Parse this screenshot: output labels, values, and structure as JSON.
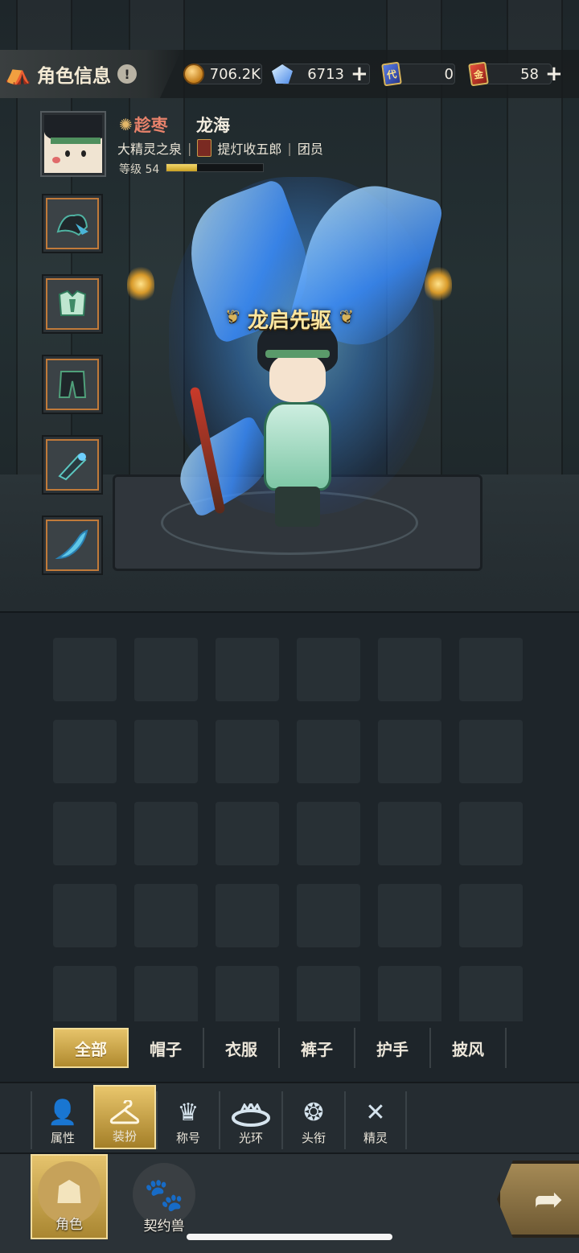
{
  "header": {
    "title": "角色信息",
    "info_icon": "!",
    "resources": [
      {
        "icon": "gold-coin-icon",
        "value": "706.2K",
        "plus": false
      },
      {
        "icon": "crystal-icon",
        "value": "6713",
        "plus": true
      },
      {
        "icon": "blue-card-icon",
        "badge": "代",
        "value": "0",
        "plus": false
      },
      {
        "icon": "red-card-icon",
        "badge": "金",
        "value": "58",
        "plus": true
      }
    ]
  },
  "player": {
    "guild_tag": "趁枣",
    "name": "龙海",
    "server": "大精灵之泉",
    "guild": "提灯收五郎",
    "role": "团员",
    "level_label": "等级 54",
    "level_progress": 0.32
  },
  "character": {
    "title": "龙启先驱"
  },
  "equipment_slots": [
    "headwear",
    "armor",
    "pants",
    "gauntlet",
    "cape"
  ],
  "inventory": {
    "rows": 5,
    "columns": 6
  },
  "category_tabs": [
    {
      "label": "全部",
      "active": true
    },
    {
      "label": "帽子",
      "active": false
    },
    {
      "label": "衣服",
      "active": false
    },
    {
      "label": "裤子",
      "active": false
    },
    {
      "label": "护手",
      "active": false
    },
    {
      "label": "披风",
      "active": false
    }
  ],
  "function_tabs": [
    {
      "label": "属性",
      "icon": "person-icon",
      "active": false
    },
    {
      "label": "装扮",
      "icon": "hanger-icon",
      "active": true
    },
    {
      "label": "称号",
      "icon": "crown-icon",
      "active": false
    },
    {
      "label": "光环",
      "icon": "halo-icon",
      "active": false
    },
    {
      "label": "头衔",
      "icon": "emblem-icon",
      "active": false
    },
    {
      "label": "精灵",
      "icon": "spirit-icon",
      "active": false
    }
  ],
  "bottom_nav": [
    {
      "label": "角色",
      "icon": "character-head-icon",
      "active": true
    },
    {
      "label": "契约兽",
      "icon": "paw-icon",
      "active": false
    }
  ]
}
